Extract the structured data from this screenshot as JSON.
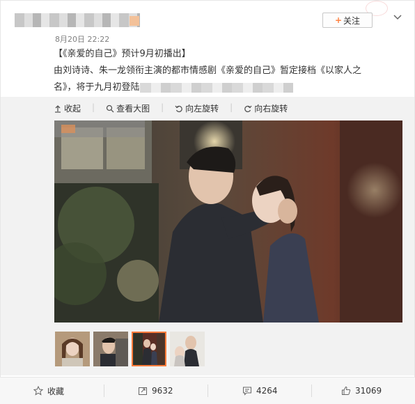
{
  "post": {
    "time": "8月20日 22:22",
    "title": "【《亲爱的自己》预计9月初播出】",
    "body_line1": "由刘诗诗、朱一龙领衔主演的都市情感剧《亲爱的自己》暂定接档《以家人之",
    "body_line2": "名》，将于九月初登陆"
  },
  "header": {
    "follow_label": "关注",
    "more_icon": "chevron-down-icon"
  },
  "toolbar": {
    "collapse_label": "收起",
    "view_large_label": "查看大图",
    "rotate_left_label": "向左旋转",
    "rotate_right_label": "向右旋转"
  },
  "actions": {
    "favorite_label": "收藏",
    "repost_count": "9632",
    "comment_count": "4264",
    "like_count": "31069"
  },
  "thumbnails": [
    "thumb-1",
    "thumb-2",
    "thumb-3",
    "thumb-4"
  ],
  "colors": {
    "accent": "#fa7d3c",
    "text": "#333333",
    "muted": "#808080"
  }
}
